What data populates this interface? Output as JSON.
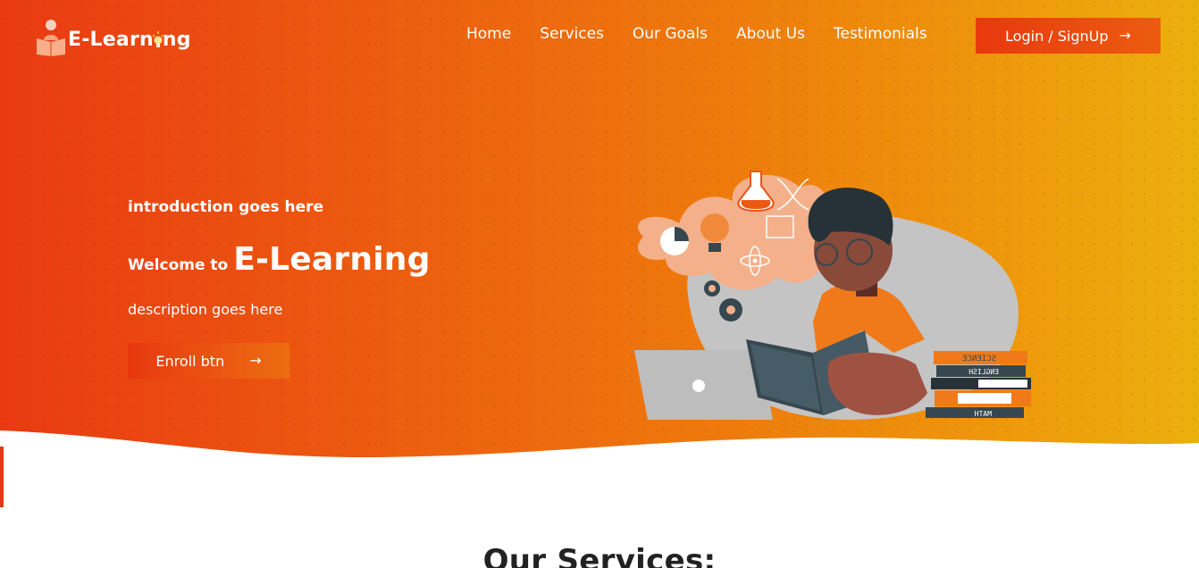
{
  "brand": {
    "name": "E-Learning",
    "name_prefix": "E-Learn",
    "name_suffix": "ng",
    "logo_icon": "reader-icon",
    "bulb_icon": "lightbulb-icon"
  },
  "nav": {
    "items": [
      "Home",
      "Services",
      "Our Goals",
      "About Us",
      "Testimonials"
    ],
    "login_label": "Login / SignUp",
    "login_icon": "arrow-right-icon"
  },
  "hero": {
    "intro": "introduction goes here",
    "welcome_prefix": "Welcome to",
    "welcome_brand": "E-Learning",
    "description": "description goes here",
    "enroll_label": "Enroll btn",
    "enroll_icon": "arrow-right-icon",
    "illustration": "student-reading-illustration",
    "book_labels": [
      "SCIENCE",
      "ENGLISH",
      "MATH"
    ]
  },
  "sections": {
    "services_title": "Our Services:"
  },
  "colors": {
    "gradient_start": "#ea3a12",
    "gradient_mid": "#ee7a0c",
    "gradient_end": "#ebb00d",
    "text": "#ffffff",
    "dark_text": "#222222"
  }
}
